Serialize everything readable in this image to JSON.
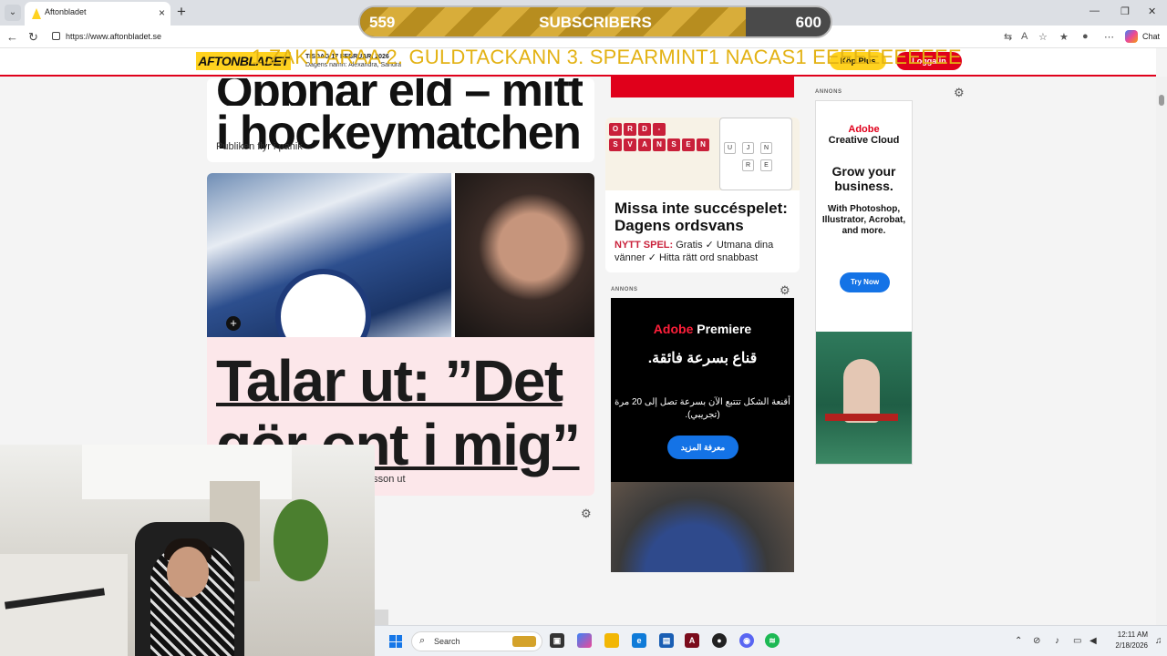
{
  "browser": {
    "tab_title": "Aftonbladet",
    "url": "https://www.aftonbladet.se",
    "chat_label": "Chat"
  },
  "overlay": {
    "sub_current": "559",
    "sub_label": "SUBSCRIBERS",
    "sub_goal": "600",
    "sub_progress": 0.82,
    "ticker": "1.ZAKIPARAA 2. GULDTACKANN  3. SPEARMINT1      NACAS1 EEEEEEEEEEE"
  },
  "site": {
    "logo": "AFTONBLADET",
    "date": "TISDAG 17 FEBRUARI 2026",
    "names_of_day": "Dagens namn: Alexandra, Sandra",
    "plus_button": "Köp Plus",
    "login_button": "Logga in"
  },
  "articles": {
    "top_headline_line1": "Öppnar eld – mitt",
    "top_headline_line2": "i hockeymatchen",
    "top_sub": "Publiken flyr i panik",
    "main_headline_line1": "Talar ut: ”Det",
    "main_headline_line2": "gör ont i mig”",
    "main_sub": "nsson ut"
  },
  "game": {
    "tiles_row1": [
      "O",
      "R",
      "D",
      "-"
    ],
    "tiles_row2": [
      "S",
      "V",
      "A",
      "N",
      "S",
      "E",
      "N"
    ],
    "grid_letters": [
      "J",
      "N",
      "R",
      "E",
      "U"
    ],
    "title": "Missa inte succéspelet: Dagens ordsvans",
    "tag": "NYTT SPEL:",
    "desc": "Gratis ✓ Utmana dina vänner ✓ Hitta rätt ord snabbast"
  },
  "ads": {
    "label": "ANNONS",
    "premiere_brand": "Adobe",
    "premiere_product": "Premiere",
    "premiere_ar_headline": "قناع بسرعة فائقة.",
    "premiere_ar_body": "أقنعة الشكل تتتبع الآن بسرعة تصل إلى 20 مرة (تجريبي).",
    "premiere_cta": "معرفة المزيد",
    "cc_brand": "Adobe",
    "cc_product": "Creative Cloud",
    "cc_headline": "Grow your business.",
    "cc_body": "With Photoshop, Illustrator, Acrobat, and more.",
    "cc_cta": "Try Now"
  },
  "taskbar": {
    "search_placeholder": "Search",
    "time": "12:11 AM",
    "date": "2/18/2026"
  },
  "colors": {
    "brand_yellow": "#ffd21f",
    "brand_red": "#e0001b",
    "adobe_blue": "#1473e6",
    "subscriber_gold": "#d8ad3a"
  }
}
